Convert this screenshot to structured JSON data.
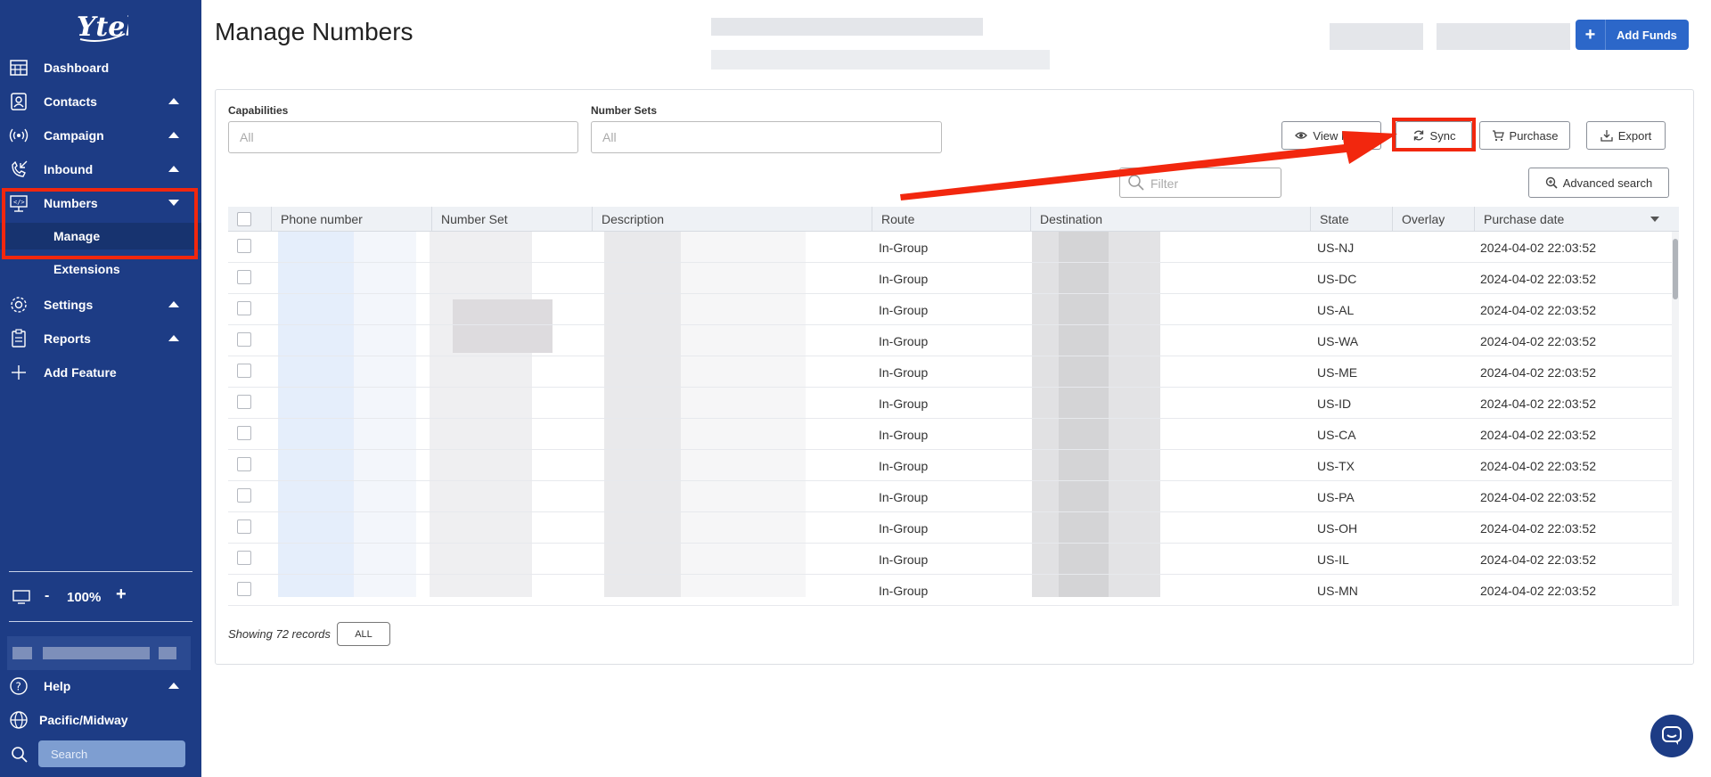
{
  "sidebar": {
    "logo_text": "Ytel",
    "items": [
      {
        "label": "Dashboard",
        "icon": "dashboard-icon"
      },
      {
        "label": "Contacts",
        "icon": "contacts-icon"
      },
      {
        "label": "Campaign",
        "icon": "campaign-icon"
      },
      {
        "label": "Inbound",
        "icon": "inbound-icon"
      },
      {
        "label": "Numbers",
        "icon": "numbers-icon"
      },
      {
        "label": "Settings",
        "icon": "settings-icon"
      },
      {
        "label": "Reports",
        "icon": "reports-icon"
      },
      {
        "label": "Add Feature",
        "icon": "plus-icon"
      }
    ],
    "sub_items": [
      "Manage",
      "Extensions"
    ],
    "zoom": {
      "minus": "-",
      "value": "100%",
      "plus": "+"
    },
    "help_label": "Help",
    "timezone_label": "Pacific/Midway",
    "search_placeholder": "Search"
  },
  "header": {
    "title": "Manage Numbers",
    "add_funds_plus": "+",
    "add_funds_label": "Add Funds"
  },
  "filters": {
    "capabilities_label": "Capabilities",
    "capabilities_placeholder": "All",
    "number_sets_label": "Number Sets",
    "number_sets_placeholder": "All",
    "filter_placeholder": "Filter"
  },
  "toolbar": {
    "view_more": "View More",
    "sync": "Sync",
    "purchase": "Purchase",
    "export": "Export",
    "advanced_search": "Advanced search"
  },
  "table": {
    "columns": [
      "Phone number",
      "Number Set",
      "Description",
      "Route",
      "Destination",
      "State",
      "Overlay",
      "Purchase date"
    ],
    "rows": [
      {
        "route": "In-Group",
        "state": "US-NJ",
        "date": "2024-04-02 22:03:52"
      },
      {
        "route": "In-Group",
        "state": "US-DC",
        "date": "2024-04-02 22:03:52"
      },
      {
        "route": "In-Group",
        "state": "US-AL",
        "date": "2024-04-02 22:03:52"
      },
      {
        "route": "In-Group",
        "state": "US-WA",
        "date": "2024-04-02 22:03:52"
      },
      {
        "route": "In-Group",
        "state": "US-ME",
        "date": "2024-04-02 22:03:52"
      },
      {
        "route": "In-Group",
        "state": "US-ID",
        "date": "2024-04-02 22:03:52"
      },
      {
        "route": "In-Group",
        "state": "US-CA",
        "date": "2024-04-02 22:03:52"
      },
      {
        "route": "In-Group",
        "state": "US-TX",
        "date": "2024-04-02 22:03:52"
      },
      {
        "route": "In-Group",
        "state": "US-PA",
        "date": "2024-04-02 22:03:52"
      },
      {
        "route": "In-Group",
        "state": "US-OH",
        "date": "2024-04-02 22:03:52"
      },
      {
        "route": "In-Group",
        "state": "US-IL",
        "date": "2024-04-02 22:03:52"
      },
      {
        "route": "In-Group",
        "state": "US-MN",
        "date": "2024-04-02 22:03:52"
      }
    ]
  },
  "footer": {
    "records_text": "Showing 72 records",
    "all_label": "ALL"
  },
  "colors": {
    "sidebar": "#1d3c85",
    "accent": "#2c67c9",
    "highlight": "#f2270e"
  }
}
